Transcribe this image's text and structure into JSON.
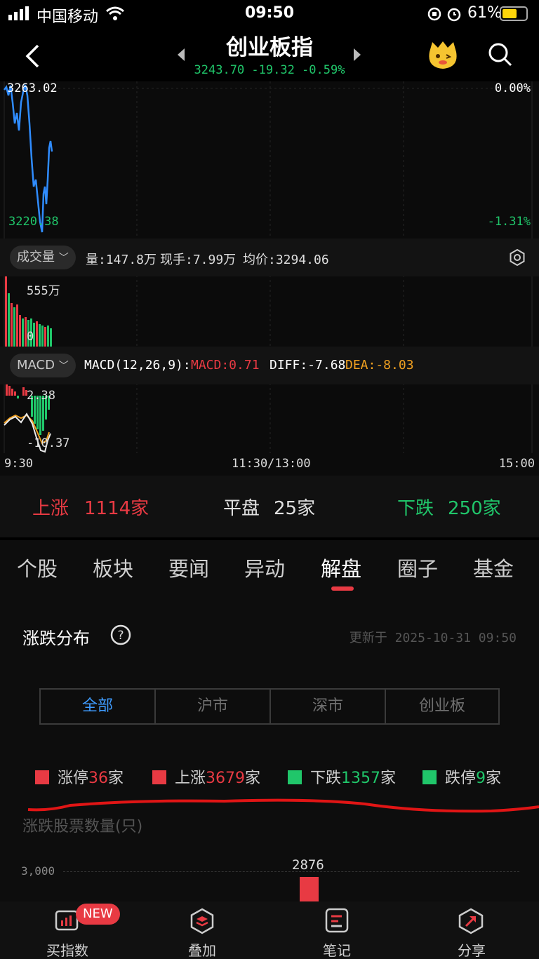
{
  "status_bar": {
    "carrier": "中国移动",
    "time": "09:50",
    "battery_percent": "61%",
    "battery_level": 0.61
  },
  "header": {
    "title": "创业板指",
    "quote": "3243.70 -19.32 -0.59%"
  },
  "chart": {
    "price_high": "3263.02",
    "price_low": "3220.38",
    "pct_high": "0.00%",
    "pct_low": "-1.31%",
    "volume_indicator": {
      "label": "成交量",
      "volume": "量:147.8万",
      "current_hand": "现手:7.99万",
      "avg_price": "均价:3294.06",
      "y_max": "555万",
      "y_min": "0"
    },
    "macd_indicator": {
      "label": "MACD",
      "params": "MACD(12,26,9):",
      "macd": "MACD:0.71",
      "diff": "DIFF:-7.68",
      "dea": "DEA:-8.03",
      "y_max": "2.38",
      "y_min": "-10.37"
    },
    "time_axis": {
      "start": "9:30",
      "mid": "11:30/13:00",
      "end": "15:00"
    }
  },
  "breadth": {
    "up_label": "上涨",
    "up_value": "1114家",
    "flat_label": "平盘",
    "flat_value": "25家",
    "down_label": "下跌",
    "down_value": "250家"
  },
  "tabs": [
    "个股",
    "板块",
    "要闻",
    "异动",
    "解盘",
    "圈子",
    "基金"
  ],
  "active_tab": "解盘",
  "distribution": {
    "title": "涨跌分布",
    "updated": "更新于 2025-10-31 09:50",
    "segments": [
      "全部",
      "沪市",
      "深市",
      "创业板"
    ],
    "active_segment": "全部",
    "legend": [
      {
        "label": "涨停",
        "value": "36",
        "unit": "家",
        "color": "#e83a43"
      },
      {
        "label": "上涨",
        "value": "3679",
        "unit": "家",
        "color": "#e83a43"
      },
      {
        "label": "下跌",
        "value": "1357",
        "unit": "家",
        "color": "#20c66a"
      },
      {
        "label": "跌停",
        "value": "9",
        "unit": "家",
        "color": "#20c66a"
      }
    ],
    "chart_label": "涨跌股票数量(只)",
    "y_tick": "3,000",
    "bar_value": "2876"
  },
  "bottom_nav": {
    "badge": "NEW",
    "items": [
      "买指数",
      "叠加",
      "笔记",
      "分享"
    ]
  },
  "colors": {
    "up": "#e83a43",
    "down": "#20c66a",
    "accent": "#3f9cff",
    "price_line": "#2f8cff"
  }
}
